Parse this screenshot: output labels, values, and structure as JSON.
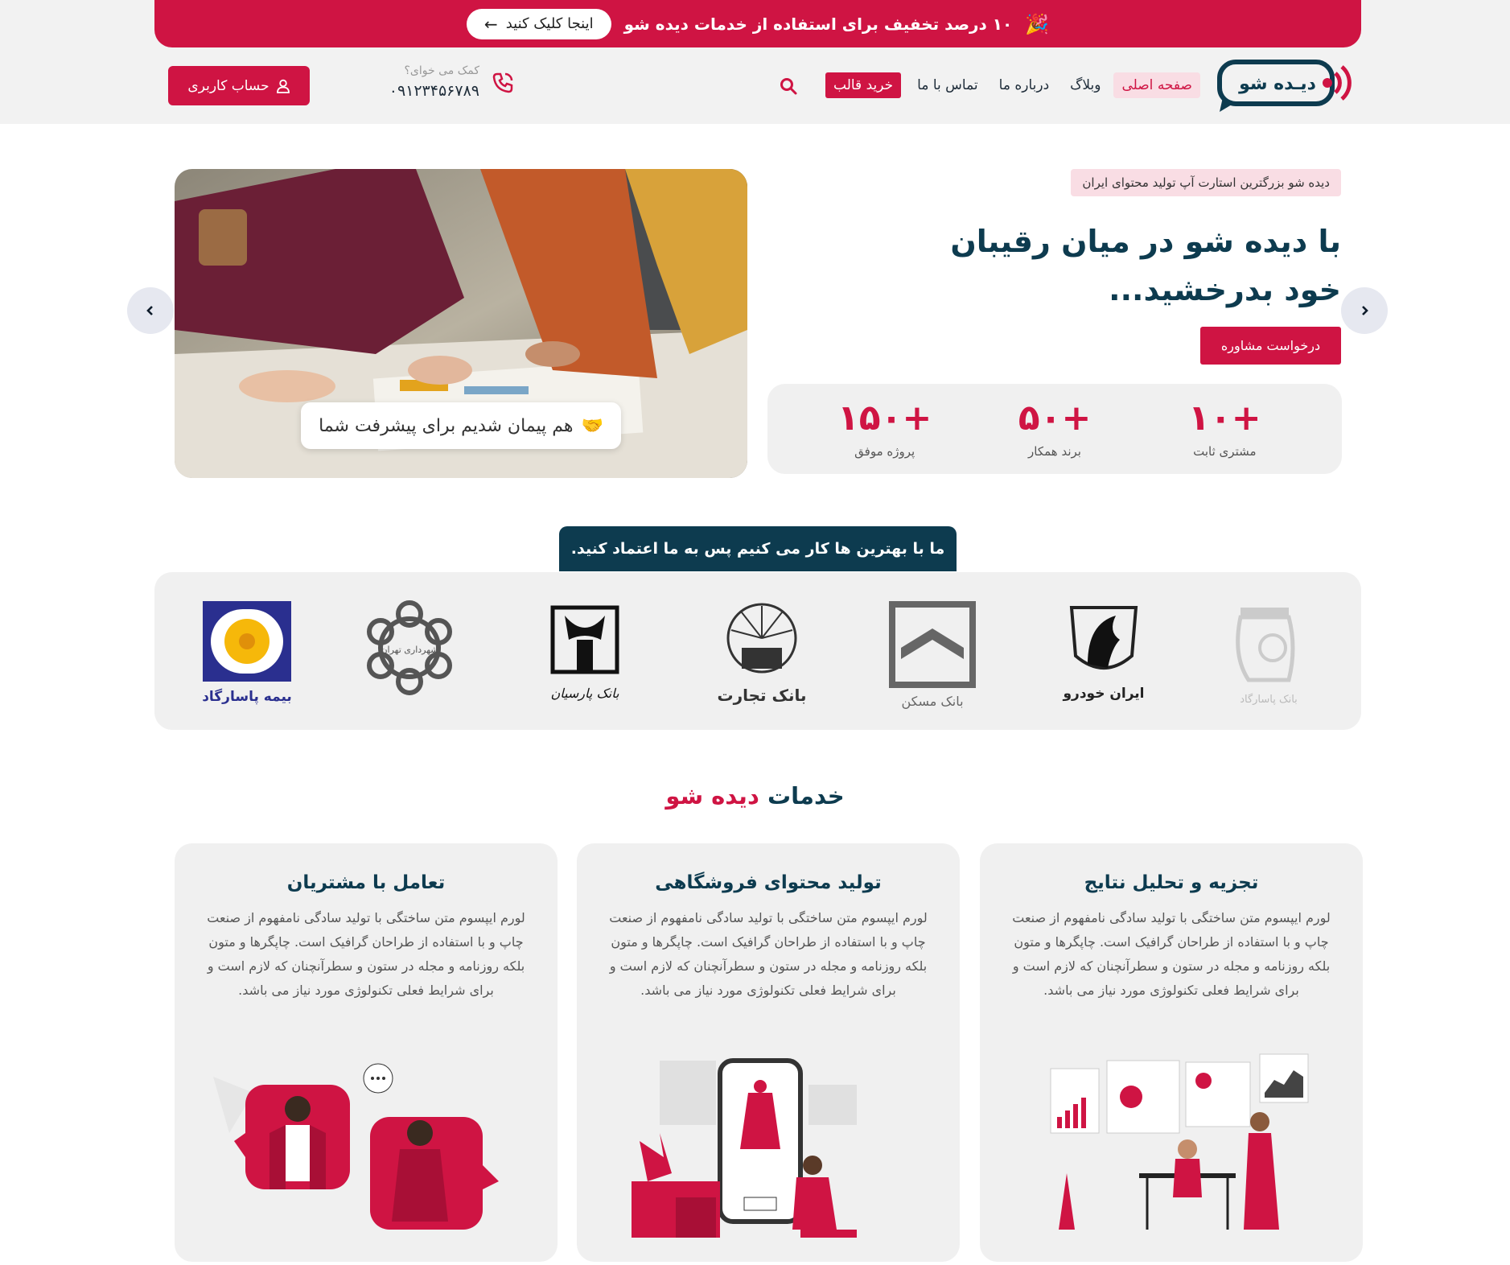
{
  "promo": {
    "text": "۱۰ درصد تخفیف برای استفاده از خدمات دیده شو",
    "icon": "party-popper-icon",
    "button_label": "اینجا کلیک کنید"
  },
  "header": {
    "logo_text": "دیـده شو",
    "nav": [
      {
        "label": "صفحه اصلی",
        "active": true
      },
      {
        "label": "وبلاگ"
      },
      {
        "label": "درباره ما"
      },
      {
        "label": "تماس با ما"
      },
      {
        "label": "خرید قالب"
      }
    ],
    "help_label": "کمک می خوای؟",
    "phone": "۰۹۱۲۳۴۵۶۷۸۹",
    "account_label": "حساب کاربری"
  },
  "hero": {
    "tag": "دیده شو بزرگترین استارت آپ تولید محتوای ایران",
    "title": "با دیده شو در میان رقیبان خود بدرخشید...",
    "cta": "درخواست مشاوره",
    "image_caption": "هم پیمان شدیم برای پیشرفت شما",
    "stats": [
      {
        "value": "+۱۰",
        "label": "مشتری ثابت"
      },
      {
        "value": "+۵۰",
        "label": "برند همکار"
      },
      {
        "value": "+۱۵۰",
        "label": "پروژه موفق"
      }
    ]
  },
  "trust": {
    "heading": "ما با بهترین ها کار می کنیم پس به ما اعتماد کنید.",
    "brands": [
      "بانک پاسارگاد",
      "ایران خودرو",
      "بانک مسکن",
      "بانک تجارت",
      "بانک پارسیان",
      "شهرداری تهران",
      "بیمه پاسارگاد"
    ]
  },
  "services": {
    "title_dark": "خدمات",
    "title_red": "دیده شو",
    "cards": [
      {
        "title": "تجزیه و تحلیل نتایج",
        "text": "لورم ایپسوم متن ساختگی با تولید سادگی نامفهوم از صنعت چاپ و با استفاده از طراحان گرافیک است. چاپگرها و متون بلکه روزنامه و مجله در ستون و سطرآنچنان که لازم است و برای شرایط فعلی تکنولوژی مورد نیاز می باشد."
      },
      {
        "title": "تولید محتوای فروشگاهی",
        "text": "لورم ایپسوم متن ساختگی با تولید سادگی نامفهوم از صنعت چاپ و با استفاده از طراحان گرافیک است. چاپگرها و متون بلکه روزنامه و مجله در ستون و سطرآنچنان که لازم است و برای شرایط فعلی تکنولوژی مورد نیاز می باشد."
      },
      {
        "title": "تعامل با مشتریان",
        "text": "لورم ایپسوم متن ساختگی با تولید سادگی نامفهوم از صنعت چاپ و با استفاده از طراحان گرافیک است. چاپگرها و متون بلکه روزنامه و مجله در ستون و سطرآنچنان که لازم است و برای شرایط فعلی تکنولوژی مورد نیاز می باشد."
      }
    ]
  },
  "colors": {
    "brand_red": "#cf1443",
    "brand_navy": "#0d3b4f",
    "panel_gray": "#f0f0f0"
  }
}
